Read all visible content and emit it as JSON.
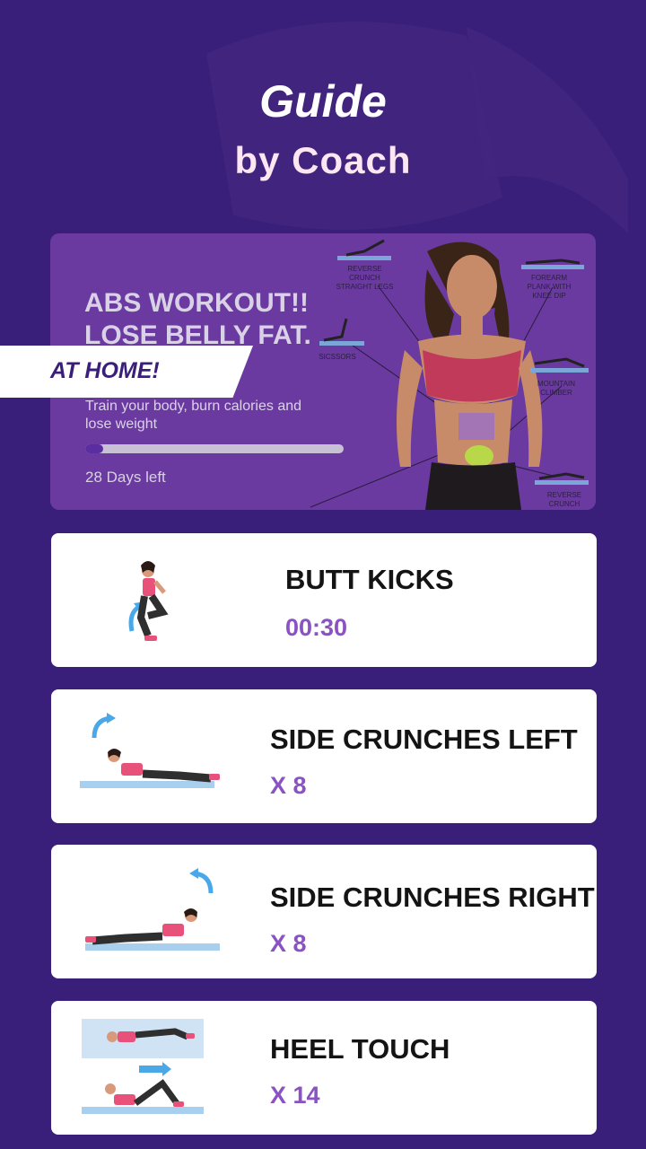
{
  "header": {
    "title": "Guide",
    "subtitle": "by Coach"
  },
  "banner": {
    "headline_line1": "ABS WORKOUT!!",
    "headline_line2": "LOSE BELLY FAT.",
    "ribbon": "AT HOME!",
    "description": "Train your body, burn calories and lose weight",
    "progress": 0.07,
    "days_left": "28 Days left",
    "diagram_labels": {
      "reverse_crunch_straight": "REVERSE CRUNCH STRAIGHT LEGS",
      "scissors": "SICSSORS",
      "forearm_plank": "FOREARM PLANK WITH KNEE DIP",
      "mountain_climber": "MOUNTAIN CLIMBER",
      "reverse_crunch": "REVERSE CRUNCH"
    }
  },
  "exercises": [
    {
      "name": "BUTT KICKS",
      "value": "00:30"
    },
    {
      "name": "SIDE CRUNCHES LEFT",
      "value": "X 8"
    },
    {
      "name": "SIDE CRUNCHES RIGHT",
      "value": "X 8"
    },
    {
      "name": "HEEL TOUCH",
      "value": "X 14"
    }
  ],
  "colors": {
    "background": "#3a1f7a",
    "banner": "#6b3aa0",
    "accent": "#8a52c2",
    "pink": "#e8527a"
  }
}
